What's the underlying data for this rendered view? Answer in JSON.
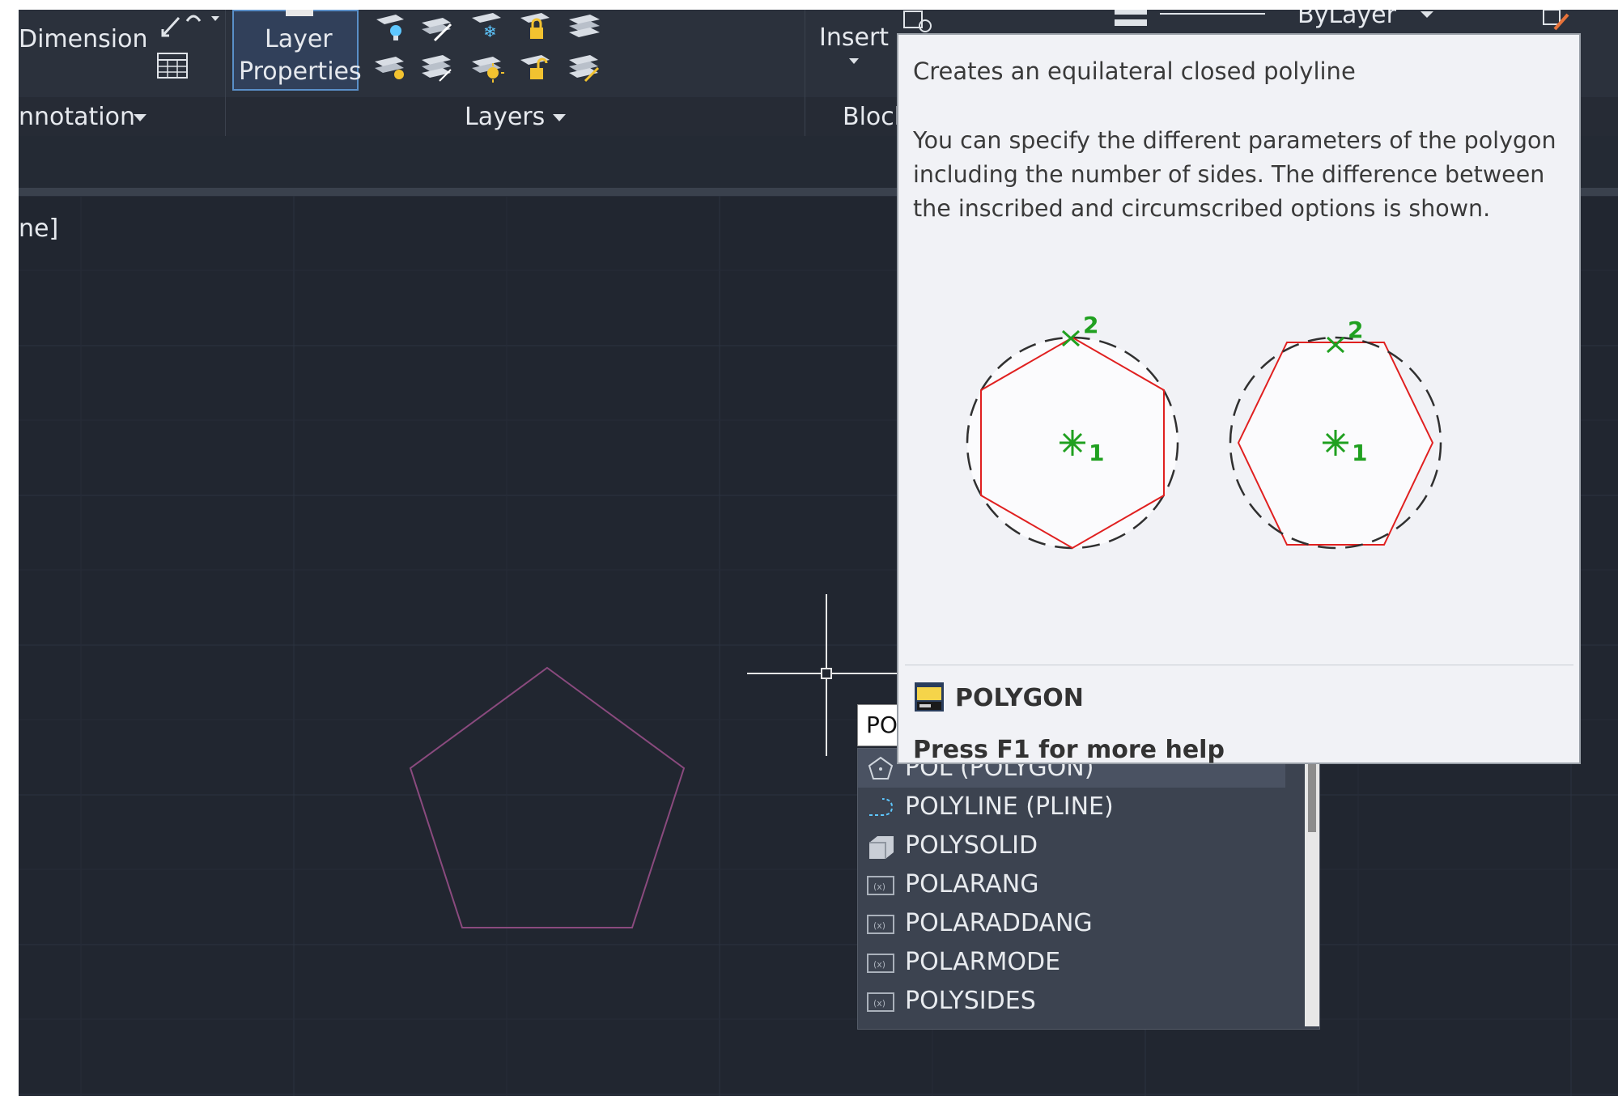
{
  "ribbon": {
    "dimension_label": "Dimension",
    "annotation_label": "nnotation",
    "layer_properties_line1": "Layer",
    "layer_properties_line2": "Properties",
    "layers_label": "Layers",
    "insert_label": "Insert",
    "block_label": "Block",
    "bylayer_label": "ByLayer"
  },
  "viewport": {
    "label_fragment": "ne]"
  },
  "tooltip": {
    "title": "Creates an equilateral closed polyline",
    "description": "You can specify the different parameters of the polygon including the number of sides. The difference between the inscribed and circumscribed options is shown.",
    "diagram_labels": {
      "center": "1",
      "radius_point": "2"
    },
    "command_name": "POLYGON",
    "help_text": "Press F1 for more help"
  },
  "command_input": {
    "value": "PO"
  },
  "autocomplete": {
    "items": [
      {
        "label": "POL (POLYGON)",
        "icon": "polygon-icon"
      },
      {
        "label": "POLYLINE (PLINE)",
        "icon": "polyline-icon"
      },
      {
        "label": "POLYSOLID",
        "icon": "polysolid-icon"
      },
      {
        "label": "POLARANG",
        "icon": "system-variable-icon"
      },
      {
        "label": "POLARADDANG",
        "icon": "system-variable-icon"
      },
      {
        "label": "POLARMODE",
        "icon": "system-variable-icon"
      },
      {
        "label": "POLYSIDES",
        "icon": "system-variable-icon"
      }
    ]
  },
  "colors": {
    "background": "#212630",
    "ribbon": "#2b313c",
    "pentagon_stroke": "#8a4a7e",
    "diagram_red": "#e02020",
    "diagram_green": "#20a020"
  }
}
